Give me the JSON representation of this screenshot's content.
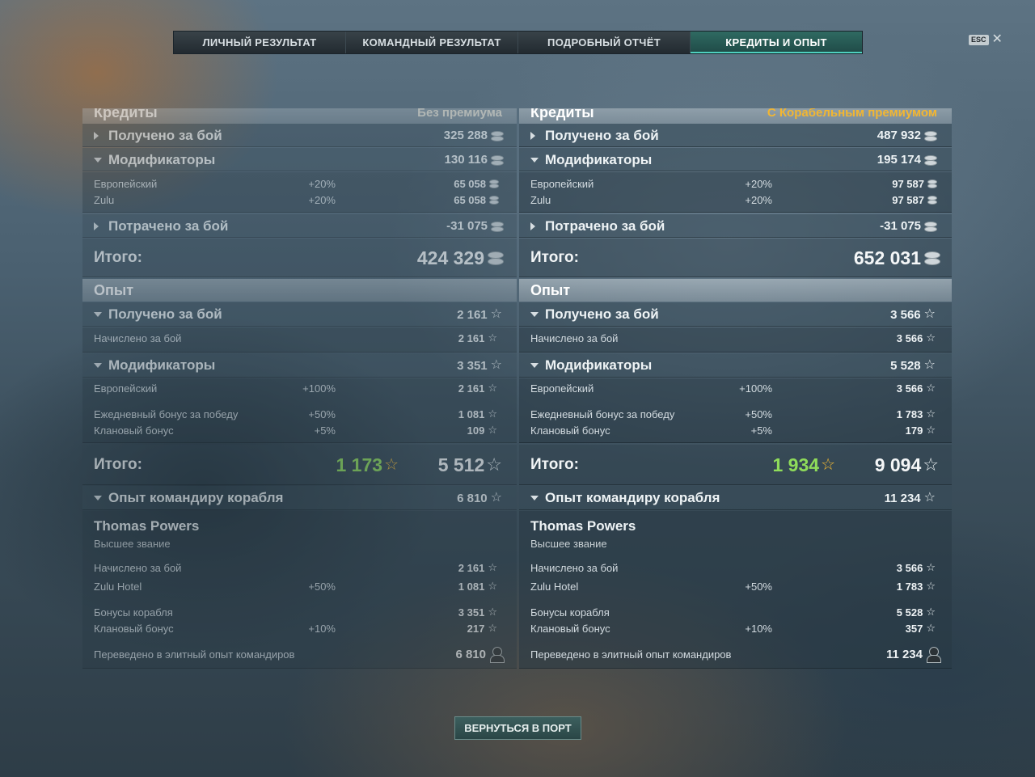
{
  "tabs": [
    {
      "label": "ЛИЧНЫЙ РЕЗУЛЬТАТ"
    },
    {
      "label": "КОМАНДНЫЙ РЕЗУЛЬТАТ"
    },
    {
      "label": "ПОДРОБНЫЙ ОТЧЁТ"
    },
    {
      "label": "КРЕДИТЫ И ОПЫТ",
      "active": true
    }
  ],
  "esc": {
    "key": "ESC",
    "close": "✕"
  },
  "left": {
    "credits_title": "Кредиты",
    "credits_sub": "Без премиума",
    "earned_label": "Получено за бой",
    "earned_value": "325 288",
    "mods_label": "Модификаторы",
    "mods_value": "130 116",
    "mod1_label": "Европейский",
    "mod1_pct": "+20%",
    "mod1_value": "65 058",
    "mod2_label": "Zulu",
    "mod2_pct": "+20%",
    "mod2_value": "65 058",
    "spent_label": "Потрачено за бой",
    "spent_value": "-31 075",
    "total_label": "Итого:",
    "total_value": "424 329",
    "xp_title": "Опыт",
    "xp_earned_label": "Получено за бой",
    "xp_earned_value": "2 161",
    "xp_credited_label": "Начислено за бой",
    "xp_credited_value": "2 161",
    "xp_mods_label": "Модификаторы",
    "xp_mods_value": "3 351",
    "xp_mod1_label": "Европейский",
    "xp_mod1_pct": "+100%",
    "xp_mod1_value": "2 161",
    "xp_mod2_label": "Ежедневный бонус за победу",
    "xp_mod2_pct": "+50%",
    "xp_mod2_value": "1 081",
    "xp_mod3_label": "Клановый бонус",
    "xp_mod3_pct": "+5%",
    "xp_mod3_value": "109",
    "xp_total_label": "Итого:",
    "xp_total_free": "1 173",
    "xp_total_value": "5 512",
    "cmdr_label": "Опыт командиру корабля",
    "cmdr_value": "6 810",
    "cmdr_name": "Thomas Powers",
    "cmdr_rank": "Высшее звание",
    "c1_label": "Начислено за бой",
    "c1_value": "2 161",
    "c2_label": "Zulu Hotel",
    "c2_pct": "+50%",
    "c2_value": "1 081",
    "c3_label": "Бонусы корабля",
    "c3_value": "3 351",
    "c4_label": "Клановый бонус",
    "c4_pct": "+10%",
    "c4_value": "217",
    "c5_label": "Переведено в элитный опыт командиров",
    "c5_value": "6 810"
  },
  "right": {
    "credits_title": "Кредиты",
    "credits_sub": "С Корабельным премиумом",
    "earned_label": "Получено за бой",
    "earned_value": "487 932",
    "mods_label": "Модификаторы",
    "mods_value": "195 174",
    "mod1_label": "Европейский",
    "mod1_pct": "+20%",
    "mod1_value": "97 587",
    "mod2_label": "Zulu",
    "mod2_pct": "+20%",
    "mod2_value": "97 587",
    "spent_label": "Потрачено за бой",
    "spent_value": "-31 075",
    "total_label": "Итого:",
    "total_value": "652 031",
    "xp_title": "Опыт",
    "xp_earned_label": "Получено за бой",
    "xp_earned_value": "3 566",
    "xp_credited_label": "Начислено за бой",
    "xp_credited_value": "3 566",
    "xp_mods_label": "Модификаторы",
    "xp_mods_value": "5 528",
    "xp_mod1_label": "Европейский",
    "xp_mod1_pct": "+100%",
    "xp_mod1_value": "3 566",
    "xp_mod2_label": "Ежедневный бонус за победу",
    "xp_mod2_pct": "+50%",
    "xp_mod2_value": "1 783",
    "xp_mod3_label": "Клановый бонус",
    "xp_mod3_pct": "+5%",
    "xp_mod3_value": "179",
    "xp_total_label": "Итого:",
    "xp_total_free": "1 934",
    "xp_total_value": "9 094",
    "cmdr_label": "Опыт командиру корабля",
    "cmdr_value": "11 234",
    "cmdr_name": "Thomas Powers",
    "cmdr_rank": "Высшее звание",
    "c1_label": "Начислено за бой",
    "c1_value": "3 566",
    "c2_label": "Zulu Hotel",
    "c2_pct": "+50%",
    "c2_value": "1 783",
    "c3_label": "Бонусы корабля",
    "c3_value": "5 528",
    "c4_label": "Клановый бонус",
    "c4_pct": "+10%",
    "c4_value": "357",
    "c5_label": "Переведено в элитный опыт командиров",
    "c5_value": "11 234"
  },
  "port_button": "ВЕРНУТЬСЯ В ПОРТ",
  "colors": {
    "accent": "#4fd1c0",
    "premium": "#f2b632",
    "free_xp": "#8fdc5a"
  },
  "icons": {
    "credits": "coin-stack-icon",
    "xp": "star-icon",
    "free_xp": "gold-star-icon",
    "elite_xp": "commander-icon"
  }
}
